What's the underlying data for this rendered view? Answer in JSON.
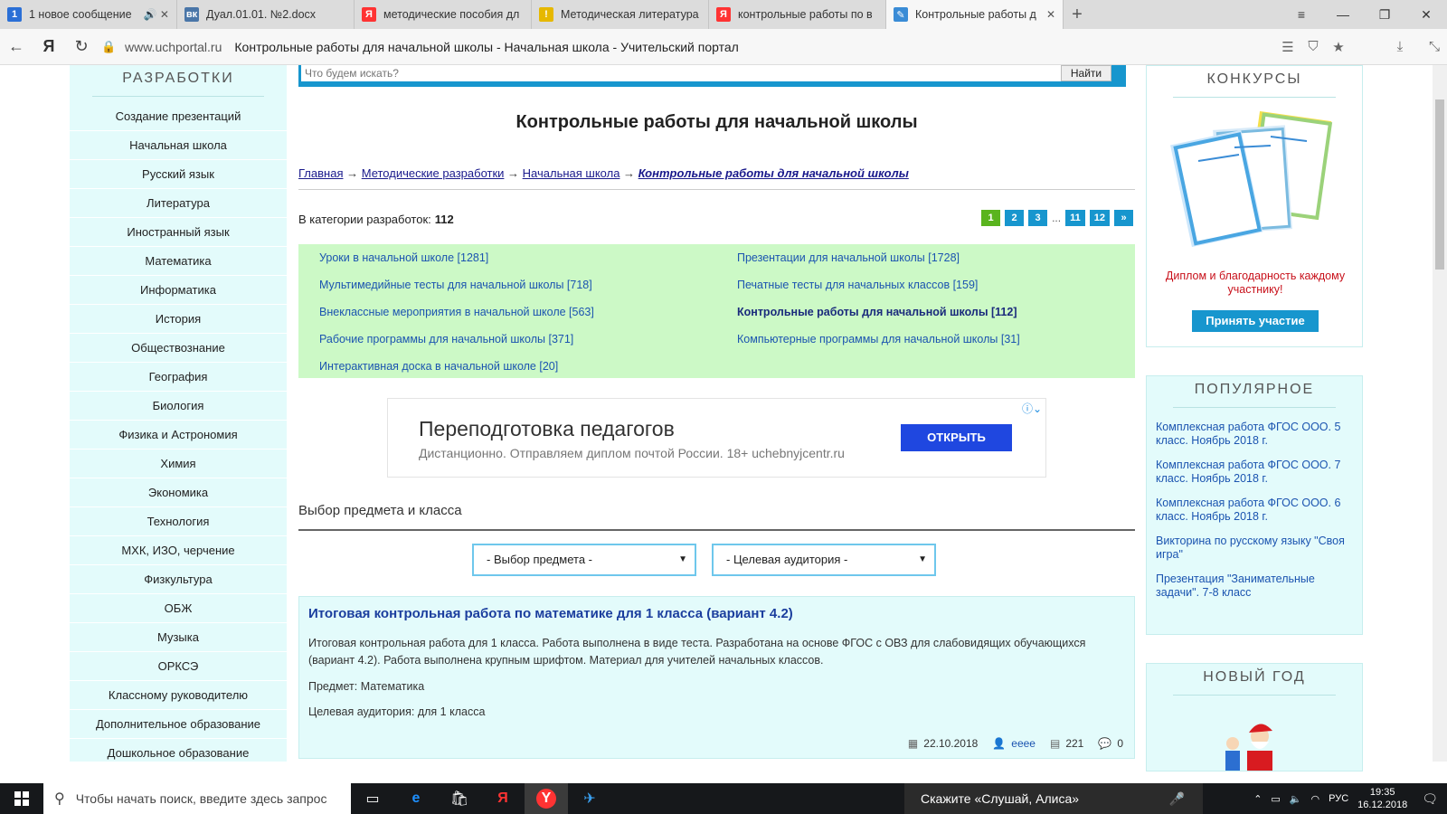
{
  "browser": {
    "tabs": [
      {
        "badge": "1",
        "title": "1 новое сообщение",
        "extra": "🔊 ✕",
        "color": "#2a6fd6"
      },
      {
        "badge": "вк",
        "title": "Дуал.01.01. №2.docx",
        "extra": "",
        "color": "#4a76a8"
      },
      {
        "badge": "Я",
        "title": "методические пособия дл",
        "extra": "",
        "color": "#f33"
      },
      {
        "badge": "!",
        "title": "Методическая литература",
        "extra": "",
        "color": "#e6b800"
      },
      {
        "badge": "Я",
        "title": "контрольные работы по в",
        "extra": "",
        "color": "#f33"
      },
      {
        "badge": "✎",
        "title": "Контрольные работы д",
        "extra": "✕",
        "color": "#3a8cd6"
      }
    ],
    "new_tab": "+",
    "domain": "www.uchportal.ru",
    "page_title": "Контрольные работы для начальной школы - Начальная школа - Учительский портал"
  },
  "left_sidebar": {
    "heading": "РАЗРАБОТКИ",
    "items": [
      "Создание презентаций",
      "Начальная школа",
      "Русский язык",
      "Литература",
      "Иностранный язык",
      "Математика",
      "Информатика",
      "История",
      "Обществознание",
      "География",
      "Биология",
      "Физика и Астрономия",
      "Химия",
      "Экономика",
      "Технология",
      "МХК, ИЗО, черчение",
      "Физкультура",
      "ОБЖ",
      "Музыка",
      "ОРКСЭ",
      "Классному руководителю",
      "Дополнительное образование",
      "Дошкольное образование"
    ]
  },
  "main": {
    "search_placeholder": "Что будем искать?",
    "search_button": "Найти",
    "heading": "Контрольные работы для начальной школы",
    "breadcrumbs": [
      "Главная",
      "Методические разработки",
      "Начальная школа",
      "Контрольные работы для начальной школы"
    ],
    "count_label": "В категории разработок:",
    "count_value": "112",
    "pages": [
      "1",
      "2",
      "3",
      "...",
      "11",
      "12",
      "»"
    ],
    "categories": [
      {
        "text": "Уроки в начальной школе [1281]",
        "current": false
      },
      {
        "text": "Презентации для начальной школы [1728]",
        "current": false
      },
      {
        "text": "Мультимедийные тесты для начальной школы [718]",
        "current": false
      },
      {
        "text": "Печатные тесты для начальных классов [159]",
        "current": false
      },
      {
        "text": "Внеклассные мероприятия в начальной школе [563]",
        "current": false
      },
      {
        "text": "Контрольные работы для начальной школы [112]",
        "current": true
      },
      {
        "text": "Рабочие программы для начальной школы [371]",
        "current": false
      },
      {
        "text": "Компьютерные программы для начальной школы [31]",
        "current": false
      },
      {
        "text": "Интерактивная доска в начальной школе [20]",
        "current": false
      }
    ],
    "ad": {
      "title": "Переподготовка педагогов",
      "subtitle": "Дистанционно. Отправляем диплом почтой России. 18+ uchebnyjcentr.ru",
      "button": "ОТКРЫТЬ"
    },
    "subject_heading": "Выбор предмета и класса",
    "select_subject": "- Выбор предмета -",
    "select_audience": "- Целевая аудитория -",
    "item": {
      "title": "Итоговая контрольная работа по математике для 1 класса (вариант 4.2)",
      "description": "Итоговая контрольная работа для 1 класса. Работа выполнена в виде теста. Разработана на основе ФГОС с ОВЗ для слабовидящих обучающихся (вариант 4.2). Работа выполнена крупным шрифтом. Материал для учителей начальных классов.",
      "subject": "Предмет: Математика",
      "audience": "Целевая аудитория: для 1 класса",
      "date": "22.10.2018",
      "author": "eeee",
      "views": "221",
      "comments": "0"
    }
  },
  "right_sidebar": {
    "konkursy_heading": "КОНКУРСЫ",
    "konkursy_caption": "Диплом и благодарность каждому участнику!",
    "konkursy_button": "Принять участие",
    "popular_heading": "ПОПУЛЯРНОЕ",
    "popular": [
      "Комплексная работа ФГОС ООО. 5 класс. Ноябрь 2018 г.",
      "Комплексная работа ФГОС ООО. 7 класс. Ноябрь 2018 г.",
      "Комплексная работа ФГОС ООО. 6 класс. Ноябрь 2018 г.",
      "Викторина по русскому языку \"Своя игра\"",
      "Презентация \"Занимательные задачи\". 7-8 класс"
    ],
    "newyear_heading": "НОВЫЙ ГОД"
  },
  "taskbar": {
    "search_placeholder": "Чтобы начать поиск, введите здесь запрос",
    "alice": "Скажите «Слушай, Алиса»",
    "lang": "РУС",
    "time": "19:35",
    "date": "16.12.2018"
  }
}
